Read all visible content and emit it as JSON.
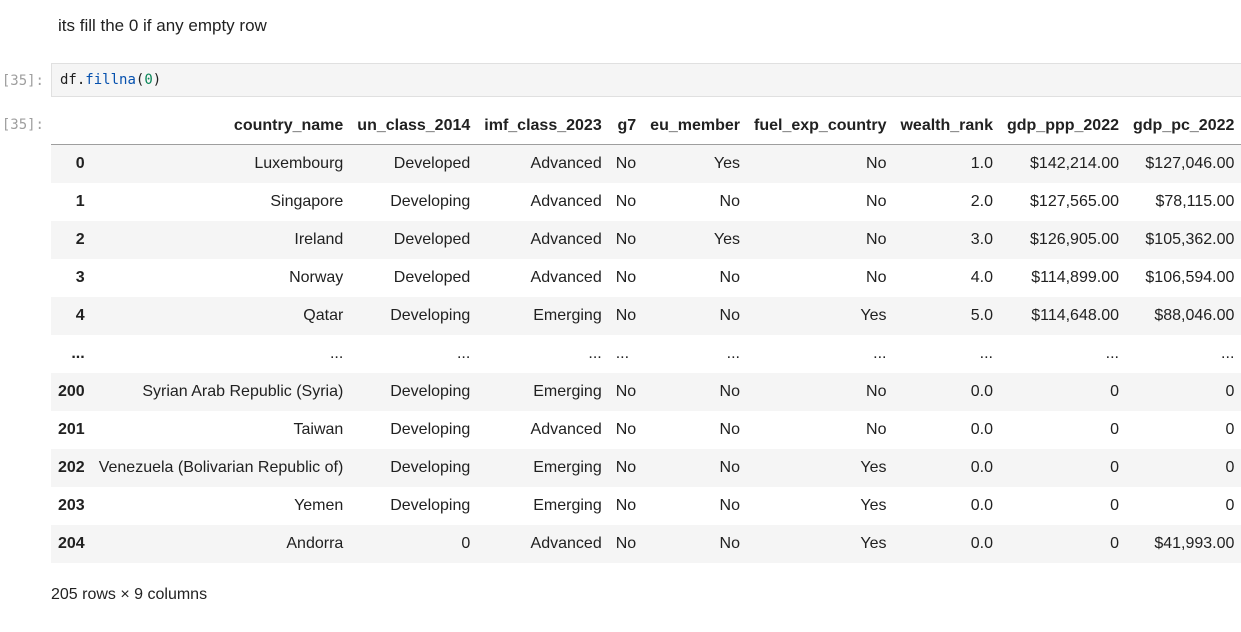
{
  "markdown": {
    "text": "its fill the 0 if any empty row"
  },
  "cell": {
    "input_prompt": "[35]:",
    "output_prompt": "[35]:",
    "code": {
      "obj": "df.",
      "fn": "fillna",
      "open": "(",
      "arg": "0",
      "close": ")"
    }
  },
  "table": {
    "headers": [
      "country_name",
      "un_class_2014",
      "imf_class_2023",
      "g7",
      "eu_member",
      "fuel_exp_country",
      "wealth_rank",
      "gdp_ppp_2022",
      "gdp_pc_2022"
    ],
    "rows": [
      {
        "index": "0",
        "cells": [
          "Luxembourg",
          "Developed",
          "Advanced",
          "No",
          "Yes",
          "No",
          "1.0",
          "$142,214.00",
          "$127,046.00"
        ]
      },
      {
        "index": "1",
        "cells": [
          "Singapore",
          "Developing",
          "Advanced",
          "No",
          "No",
          "No",
          "2.0",
          "$127,565.00",
          "$78,115.00"
        ]
      },
      {
        "index": "2",
        "cells": [
          "Ireland",
          "Developed",
          "Advanced",
          "No",
          "Yes",
          "No",
          "3.0",
          "$126,905.00",
          "$105,362.00"
        ]
      },
      {
        "index": "3",
        "cells": [
          "Norway",
          "Developed",
          "Advanced",
          "No",
          "No",
          "No",
          "4.0",
          "$114,899.00",
          "$106,594.00"
        ]
      },
      {
        "index": "4",
        "cells": [
          "Qatar",
          "Developing",
          "Emerging",
          "No",
          "No",
          "Yes",
          "5.0",
          "$114,648.00",
          "$88,046.00"
        ]
      },
      {
        "index": "...",
        "cells": [
          "...",
          "...",
          "...",
          "...",
          "...",
          "...",
          "...",
          "...",
          "..."
        ]
      },
      {
        "index": "200",
        "cells": [
          "Syrian Arab Republic (Syria)",
          "Developing",
          "Emerging",
          "No",
          "No",
          "No",
          "0.0",
          "0",
          "0"
        ]
      },
      {
        "index": "201",
        "cells": [
          "Taiwan",
          "Developing",
          "Advanced",
          "No",
          "No",
          "No",
          "0.0",
          "0",
          "0"
        ]
      },
      {
        "index": "202",
        "cells": [
          "Venezuela (Bolivarian Republic of)",
          "Developing",
          "Emerging",
          "No",
          "No",
          "Yes",
          "0.0",
          "0",
          "0"
        ]
      },
      {
        "index": "203",
        "cells": [
          "Yemen",
          "Developing",
          "Emerging",
          "No",
          "No",
          "Yes",
          "0.0",
          "0",
          "0"
        ]
      },
      {
        "index": "204",
        "cells": [
          "Andorra",
          "0",
          "Advanced",
          "No",
          "No",
          "Yes",
          "0.0",
          "0",
          "$41,993.00"
        ]
      }
    ]
  },
  "footer": {
    "text": "205 rows × 9 columns"
  }
}
